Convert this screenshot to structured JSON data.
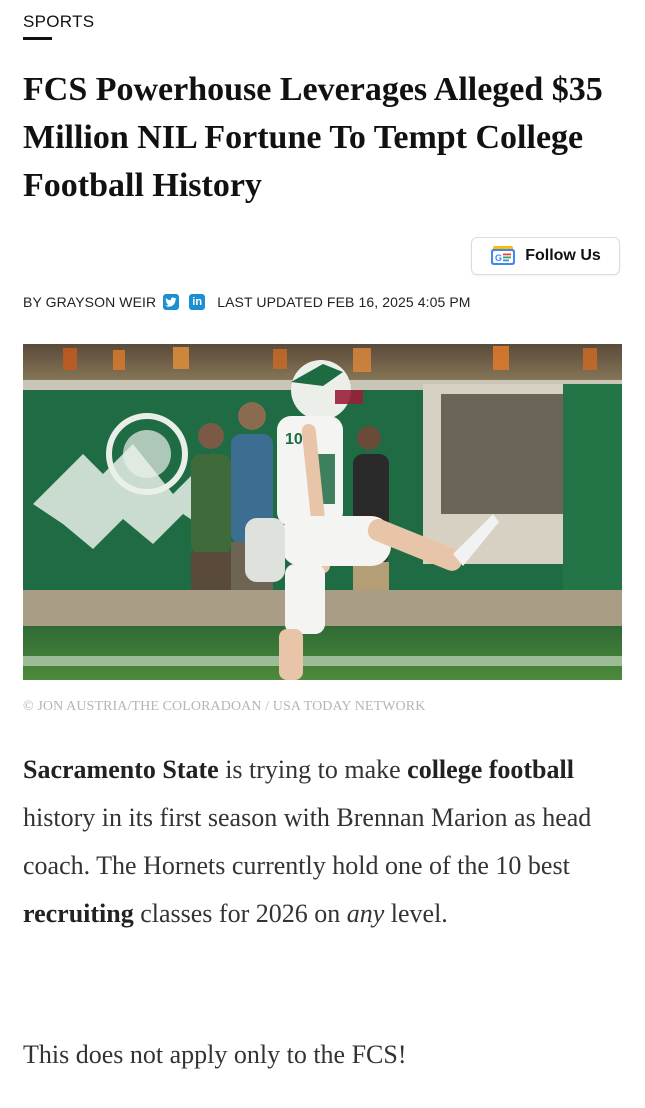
{
  "section": {
    "label": "SPORTS"
  },
  "article": {
    "headline": "FCS Powerhouse Leverages Alleged $35 Million NIL Fortune To Tempt College Football History"
  },
  "follow_button": {
    "icon": "google-news-icon",
    "label": "Follow Us"
  },
  "byline": {
    "author": "BY GRAYSON WEIR",
    "social_icons": [
      "twitter-icon",
      "linkedin-icon"
    ],
    "updated": "LAST UPDATED FEB 16, 2025 4:05 PM"
  },
  "photo": {
    "jersey_number": "10",
    "caption": "© JON AUSTRIA/THE COLORADOAN / USA TODAY NETWORK"
  },
  "body": {
    "p1": {
      "s1": "Sacramento State",
      "s2": " is trying to make ",
      "s3": "college football",
      "s4": " history in its first season with Brennan Marion as head coach. The Hornets currently hold one of the 10 best ",
      "s5": "recruiting",
      "s6": " classes for 2026 on ",
      "s7": "any",
      "s8": " level."
    },
    "p2": "This does not apply only to the FCS!"
  },
  "colors": {
    "link_blue": "#1d8fd0",
    "stadium_green": "#1f6b43",
    "caption_gray": "#b5b5b5"
  }
}
